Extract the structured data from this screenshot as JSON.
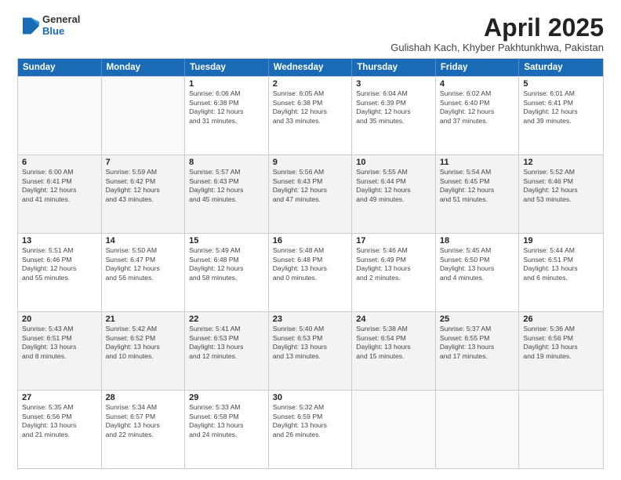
{
  "header": {
    "logo": {
      "line1": "General",
      "line2": "Blue"
    },
    "title": "April 2025",
    "subtitle": "Gulishah Kach, Khyber Pakhtunkhwa, Pakistan"
  },
  "calendar": {
    "days": [
      "Sunday",
      "Monday",
      "Tuesday",
      "Wednesday",
      "Thursday",
      "Friday",
      "Saturday"
    ],
    "rows": [
      [
        {
          "date": "",
          "info": ""
        },
        {
          "date": "",
          "info": ""
        },
        {
          "date": "1",
          "info": "Sunrise: 6:06 AM\nSunset: 6:38 PM\nDaylight: 12 hours\nand 31 minutes."
        },
        {
          "date": "2",
          "info": "Sunrise: 6:05 AM\nSunset: 6:38 PM\nDaylight: 12 hours\nand 33 minutes."
        },
        {
          "date": "3",
          "info": "Sunrise: 6:04 AM\nSunset: 6:39 PM\nDaylight: 12 hours\nand 35 minutes."
        },
        {
          "date": "4",
          "info": "Sunrise: 6:02 AM\nSunset: 6:40 PM\nDaylight: 12 hours\nand 37 minutes."
        },
        {
          "date": "5",
          "info": "Sunrise: 6:01 AM\nSunset: 6:41 PM\nDaylight: 12 hours\nand 39 minutes."
        }
      ],
      [
        {
          "date": "6",
          "info": "Sunrise: 6:00 AM\nSunset: 6:41 PM\nDaylight: 12 hours\nand 41 minutes."
        },
        {
          "date": "7",
          "info": "Sunrise: 5:59 AM\nSunset: 6:42 PM\nDaylight: 12 hours\nand 43 minutes."
        },
        {
          "date": "8",
          "info": "Sunrise: 5:57 AM\nSunset: 6:43 PM\nDaylight: 12 hours\nand 45 minutes."
        },
        {
          "date": "9",
          "info": "Sunrise: 5:56 AM\nSunset: 6:43 PM\nDaylight: 12 hours\nand 47 minutes."
        },
        {
          "date": "10",
          "info": "Sunrise: 5:55 AM\nSunset: 6:44 PM\nDaylight: 12 hours\nand 49 minutes."
        },
        {
          "date": "11",
          "info": "Sunrise: 5:54 AM\nSunset: 6:45 PM\nDaylight: 12 hours\nand 51 minutes."
        },
        {
          "date": "12",
          "info": "Sunrise: 5:52 AM\nSunset: 6:46 PM\nDaylight: 12 hours\nand 53 minutes."
        }
      ],
      [
        {
          "date": "13",
          "info": "Sunrise: 5:51 AM\nSunset: 6:46 PM\nDaylight: 12 hours\nand 55 minutes."
        },
        {
          "date": "14",
          "info": "Sunrise: 5:50 AM\nSunset: 6:47 PM\nDaylight: 12 hours\nand 56 minutes."
        },
        {
          "date": "15",
          "info": "Sunrise: 5:49 AM\nSunset: 6:48 PM\nDaylight: 12 hours\nand 58 minutes."
        },
        {
          "date": "16",
          "info": "Sunrise: 5:48 AM\nSunset: 6:48 PM\nDaylight: 13 hours\nand 0 minutes."
        },
        {
          "date": "17",
          "info": "Sunrise: 5:46 AM\nSunset: 6:49 PM\nDaylight: 13 hours\nand 2 minutes."
        },
        {
          "date": "18",
          "info": "Sunrise: 5:45 AM\nSunset: 6:50 PM\nDaylight: 13 hours\nand 4 minutes."
        },
        {
          "date": "19",
          "info": "Sunrise: 5:44 AM\nSunset: 6:51 PM\nDaylight: 13 hours\nand 6 minutes."
        }
      ],
      [
        {
          "date": "20",
          "info": "Sunrise: 5:43 AM\nSunset: 6:51 PM\nDaylight: 13 hours\nand 8 minutes."
        },
        {
          "date": "21",
          "info": "Sunrise: 5:42 AM\nSunset: 6:52 PM\nDaylight: 13 hours\nand 10 minutes."
        },
        {
          "date": "22",
          "info": "Sunrise: 5:41 AM\nSunset: 6:53 PM\nDaylight: 13 hours\nand 12 minutes."
        },
        {
          "date": "23",
          "info": "Sunrise: 5:40 AM\nSunset: 6:53 PM\nDaylight: 13 hours\nand 13 minutes."
        },
        {
          "date": "24",
          "info": "Sunrise: 5:38 AM\nSunset: 6:54 PM\nDaylight: 13 hours\nand 15 minutes."
        },
        {
          "date": "25",
          "info": "Sunrise: 5:37 AM\nSunset: 6:55 PM\nDaylight: 13 hours\nand 17 minutes."
        },
        {
          "date": "26",
          "info": "Sunrise: 5:36 AM\nSunset: 6:56 PM\nDaylight: 13 hours\nand 19 minutes."
        }
      ],
      [
        {
          "date": "27",
          "info": "Sunrise: 5:35 AM\nSunset: 6:56 PM\nDaylight: 13 hours\nand 21 minutes."
        },
        {
          "date": "28",
          "info": "Sunrise: 5:34 AM\nSunset: 6:57 PM\nDaylight: 13 hours\nand 22 minutes."
        },
        {
          "date": "29",
          "info": "Sunrise: 5:33 AM\nSunset: 6:58 PM\nDaylight: 13 hours\nand 24 minutes."
        },
        {
          "date": "30",
          "info": "Sunrise: 5:32 AM\nSunset: 6:59 PM\nDaylight: 13 hours\nand 26 minutes."
        },
        {
          "date": "",
          "info": ""
        },
        {
          "date": "",
          "info": ""
        },
        {
          "date": "",
          "info": ""
        }
      ]
    ]
  }
}
